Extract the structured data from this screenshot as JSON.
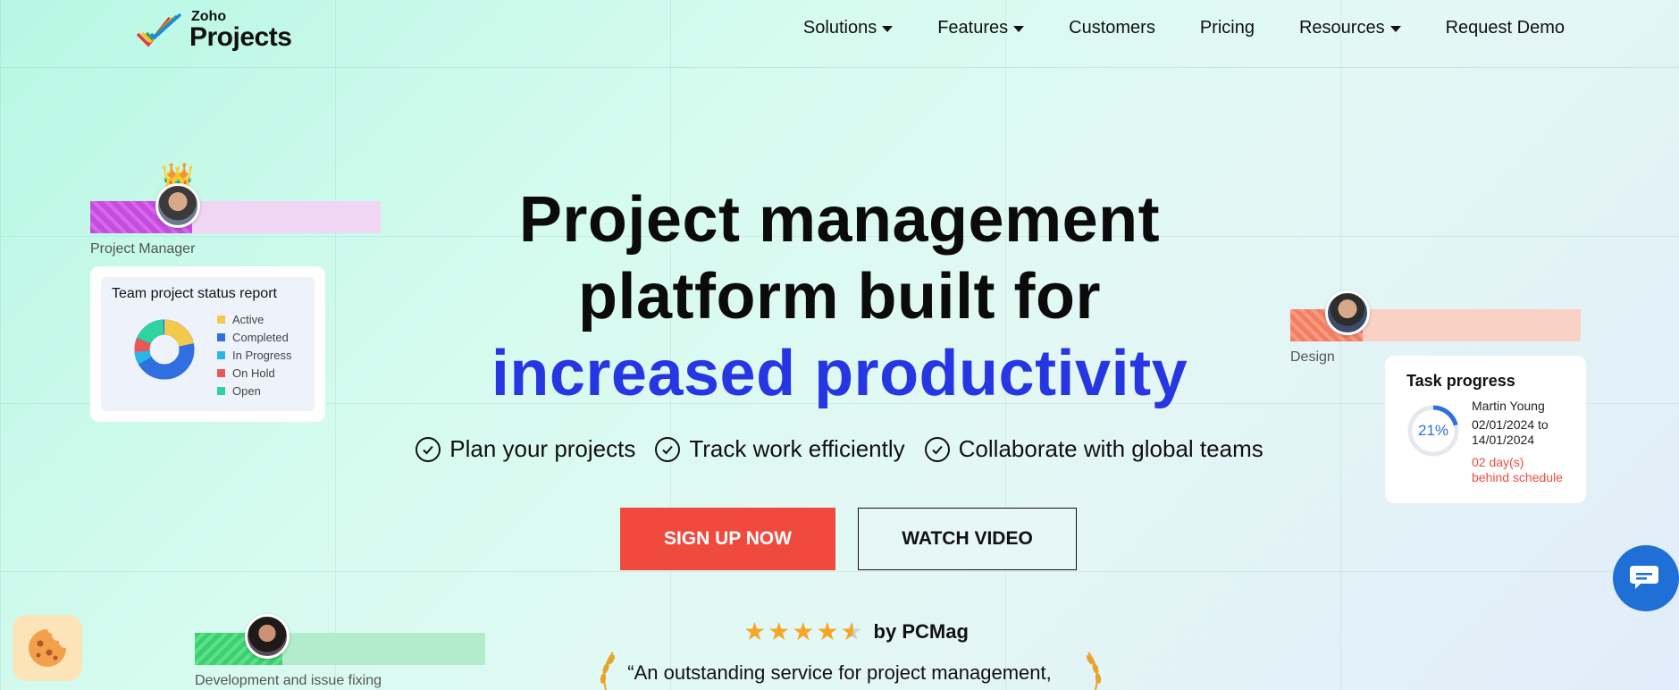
{
  "header": {
    "logo": {
      "brand": "Zoho",
      "product": "Projects"
    },
    "nav": [
      {
        "label": "Solutions",
        "has_dropdown": true
      },
      {
        "label": "Features",
        "has_dropdown": true
      },
      {
        "label": "Customers",
        "has_dropdown": false
      },
      {
        "label": "Pricing",
        "has_dropdown": false
      },
      {
        "label": "Resources",
        "has_dropdown": true
      },
      {
        "label": "Request Demo",
        "has_dropdown": false
      }
    ]
  },
  "hero": {
    "title_line1": "Project management",
    "title_line2": "platform built for",
    "title_line3": "increased productivity",
    "features": [
      "Plan your projects",
      "Track work efficiently",
      "Collaborate with global teams"
    ],
    "primary_cta": "SIGN UP NOW",
    "secondary_cta": "WATCH VIDEO",
    "rating": {
      "stars": 4.5,
      "source": "by PCMag"
    },
    "quote": "“An outstanding service for project management,"
  },
  "colors": {
    "accent_blue": "#2636e3",
    "cta_red": "#f04a3e",
    "pm_bar": "#c84be0",
    "design_bar": "#f47e62",
    "dev_bar": "#3bd16f",
    "chat_blue": "#1f6fd6"
  },
  "cards": {
    "project_manager": {
      "label": "Project Manager",
      "progress": 0.35
    },
    "design": {
      "label": "Design",
      "progress": 0.25
    },
    "development": {
      "label": "Development and issue fixing",
      "progress": 0.3
    },
    "status_report": {
      "title": "Team project status report",
      "legend": [
        {
          "label": "Active",
          "color": "#f2c94c"
        },
        {
          "label": "Completed",
          "color": "#2f6fe0"
        },
        {
          "label": "In Progress",
          "color": "#29b6e6"
        },
        {
          "label": "On Hold",
          "color": "#eb5757"
        },
        {
          "label": "Open",
          "color": "#2fd3a0"
        }
      ]
    },
    "task_progress": {
      "title": "Task progress",
      "percent": "21%",
      "percent_value": 21,
      "assignee": "Martin Young",
      "date_range_line1": "02/01/2024 to",
      "date_range_line2": "14/01/2024",
      "status_line1": "02 day(s)",
      "status_line2": "behind schedule"
    }
  },
  "widgets": {
    "chat_icon": "chat-bubble-icon",
    "cookie_icon": "cookie-icon"
  }
}
